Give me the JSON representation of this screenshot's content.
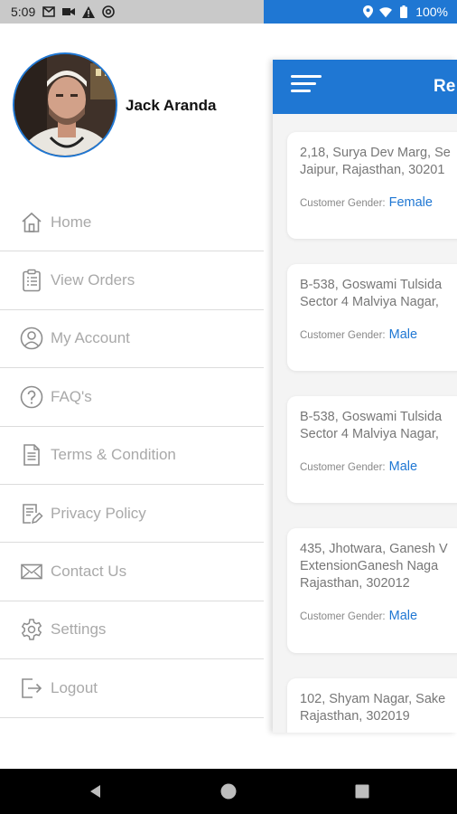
{
  "status_bar": {
    "time": "5:09",
    "battery": "100%",
    "left_icons": [
      "gmail-icon",
      "video-icon",
      "warning-icon",
      "at-sign-icon"
    ],
    "right_icons": [
      "location-icon",
      "wifi-icon",
      "battery-icon"
    ]
  },
  "drawer": {
    "user_name": "Jack Aranda",
    "menu": [
      {
        "label": "Home",
        "icon": "home-icon"
      },
      {
        "label": "View Orders",
        "icon": "clipboard-icon"
      },
      {
        "label": "My Account",
        "icon": "user-circle-icon"
      },
      {
        "label": "FAQ's",
        "icon": "question-icon"
      },
      {
        "label": "Terms & Condition",
        "icon": "document-icon"
      },
      {
        "label": "Privacy Policy",
        "icon": "policy-edit-icon"
      },
      {
        "label": "Contact Us",
        "icon": "envelope-icon"
      },
      {
        "label": "Settings",
        "icon": "gear-icon"
      },
      {
        "label": "Logout",
        "icon": "logout-icon"
      }
    ]
  },
  "app": {
    "header_title": "Re",
    "gender_label": "Customer Gender:",
    "cards": [
      {
        "address": "2,18, Surya Dev Marg, Se\nJaipur, Rajasthan, 30201",
        "gender": "Female"
      },
      {
        "address": "B-538, Goswami Tulsida\nSector 4 Malviya Nagar,",
        "gender": "Male"
      },
      {
        "address": "B-538, Goswami Tulsida\nSector 4 Malviya Nagar,",
        "gender": "Male"
      },
      {
        "address": "435, Jhotwara, Ganesh V\nExtensionGanesh Naga\nRajasthan, 302012",
        "gender": "Male"
      },
      {
        "address": "102, Shyam Nagar, Sake\nRajasthan, 302019",
        "gender": ""
      }
    ]
  },
  "colors": {
    "accent": "#1f77d3",
    "menu_text": "#a9a9a9",
    "divider": "#dcdcdc"
  }
}
